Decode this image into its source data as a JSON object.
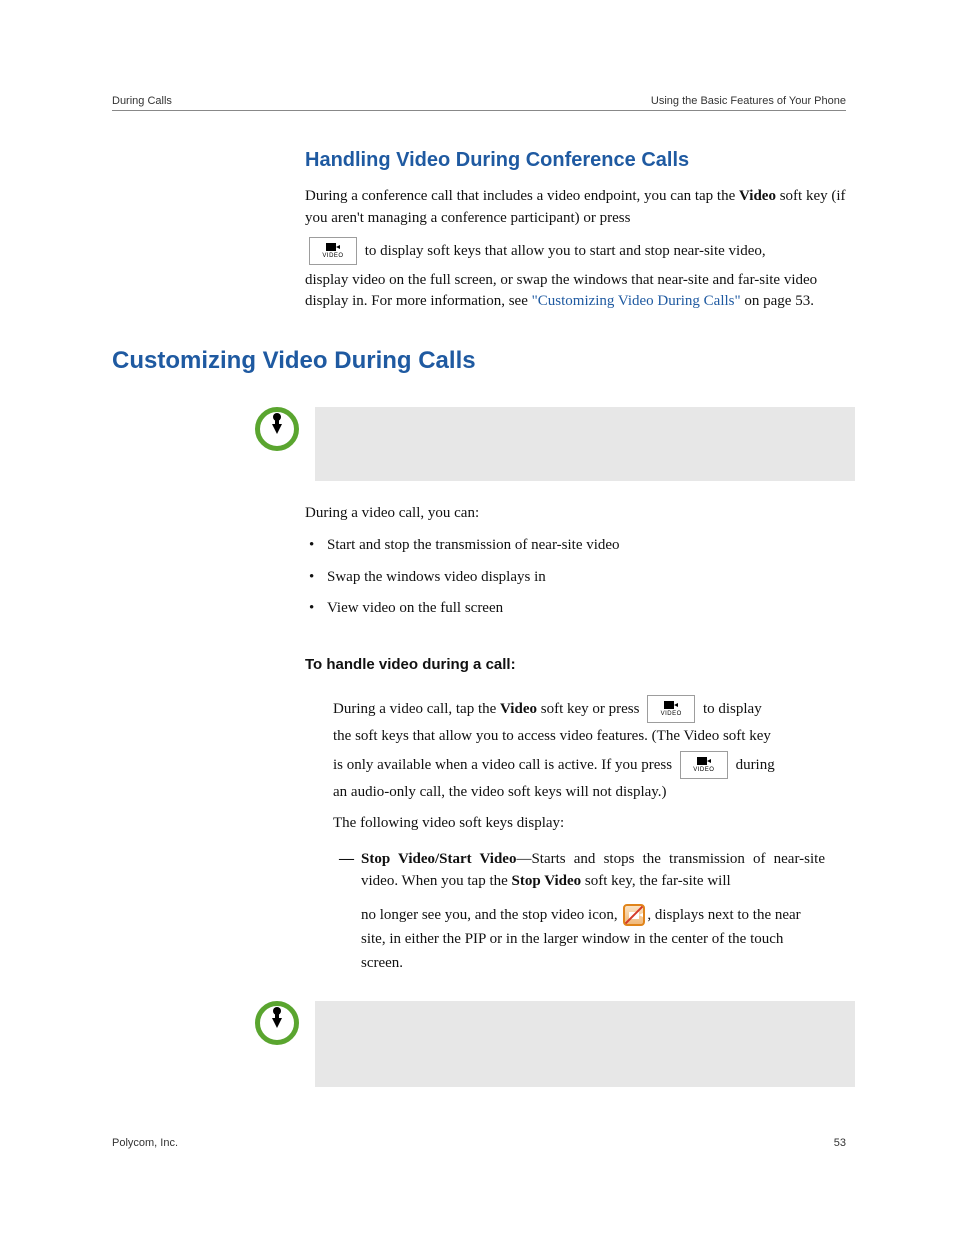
{
  "header": {
    "left": "During Calls",
    "right": "Using the Basic Features of Your Phone"
  },
  "sec1": {
    "title": "Handling Video During Conference Calls",
    "p1a": "During a conference call that includes a video endpoint, you can tap the ",
    "p1b_bold": "Video",
    "p1c": " soft key (if you aren't managing a conference participant) or press ",
    "p2a": " to display soft keys that allow you to start and stop near-site video, ",
    "p3a": "display video on the full screen, or swap the windows that near-site and far-site video display in. For more information, see ",
    "link": "\"Customizing Video During Calls\"",
    "p3b": " on page 53."
  },
  "sec2": {
    "title": "Customizing Video During Calls",
    "intro": "During a video call, you can:",
    "bullets": [
      "Start and stop the transmission of near-site video",
      "Swap the windows video displays in",
      "View video on the full screen"
    ],
    "subhead": "To handle video during a call:",
    "p1a": "During a video call, tap the ",
    "p1b_bold": "Video",
    "p1c": " soft key or press ",
    "p1d": " to display ",
    "p2": "the soft keys that allow you to access video features. (The Video soft key ",
    "p3a": "is only available when a video call is active. If you press ",
    "p3b": " during ",
    "p4": "an audio-only call, the video soft keys will not display.)",
    "p5": "The following video soft keys display:",
    "dash": {
      "lead_bold": "Stop Video/Start Video",
      "t1": "—Starts and stops the transmission of near-site video. When you tap the ",
      "t2_bold": "Stop Video",
      "t3": " soft key, the far-site will ",
      "t4": "no longer see you, and the stop video icon, ",
      "t5": ", displays next to the near site, in either the PIP or in the larger window in the center of the touch screen."
    }
  },
  "videokey_label": "VIDEO",
  "footer": {
    "left": "Polycom, Inc.",
    "right": "53"
  }
}
